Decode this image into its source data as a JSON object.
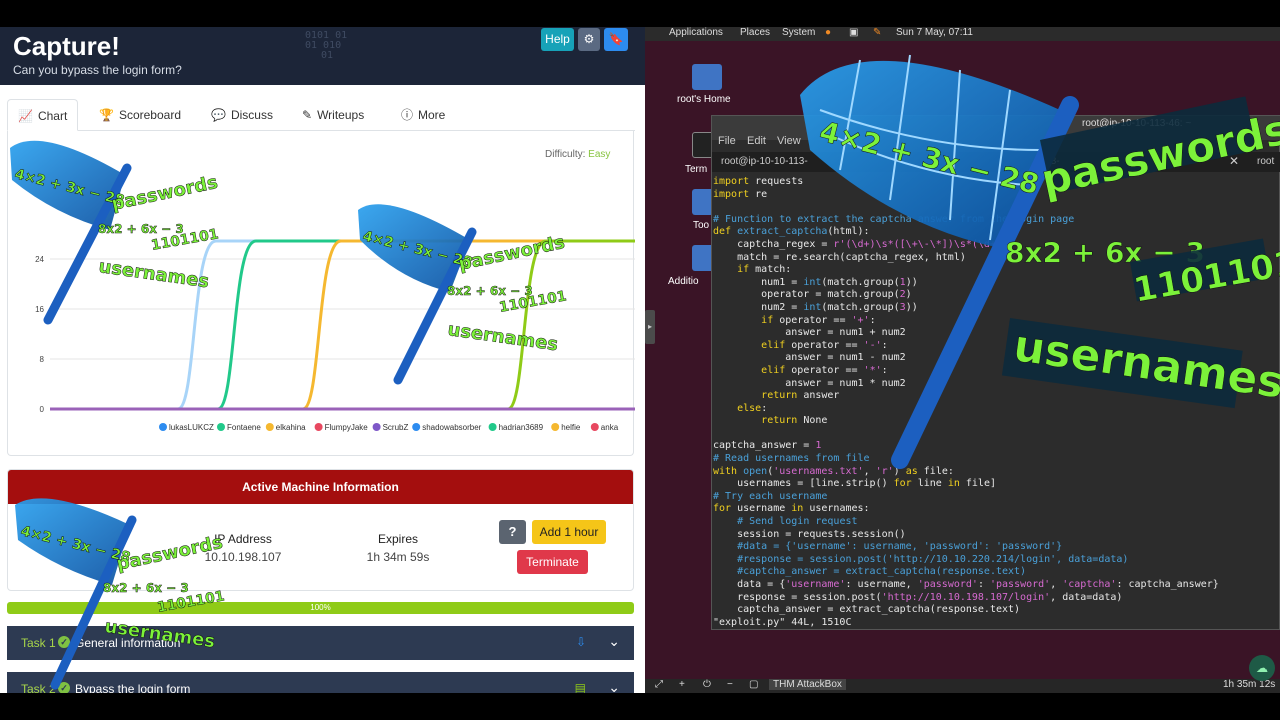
{
  "header": {
    "title": "Capture!",
    "subtitle": "Can you bypass the login form?",
    "binary": [
      "0101 01",
      "01  010",
      "01"
    ],
    "help_label": "Help"
  },
  "tabs": [
    {
      "label": "Chart",
      "icon": "chart-icon"
    },
    {
      "label": "Scoreboard",
      "icon": "trophy-icon"
    },
    {
      "label": "Discuss",
      "icon": "comments-icon"
    },
    {
      "label": "Writeups",
      "icon": "pen-icon"
    },
    {
      "label": "More",
      "icon": "info-icon"
    }
  ],
  "difficulty": {
    "label": "Difficulty:",
    "value": "Easy",
    "color": "#89c442"
  },
  "chart_data": {
    "type": "line",
    "y_ticks": [
      "0",
      "8",
      "16",
      "24"
    ],
    "ylim": [
      0,
      32
    ],
    "legend_position": "bottom",
    "series": [
      {
        "name": "lukasLUKCZ",
        "color": "#2d8cf0"
      },
      {
        "name": "Fontaene",
        "color": "#21c98a"
      },
      {
        "name": "elkahina",
        "color": "#f5b830"
      },
      {
        "name": "FlumpyJake",
        "color": "#e84860"
      },
      {
        "name": "ScrubZ",
        "color": "#7e58c8"
      },
      {
        "name": "shadowabsorber",
        "color": "#2d8cf0"
      },
      {
        "name": "hadrian3689",
        "color": "#21c98a"
      },
      {
        "name": "helfie",
        "color": "#f5b830"
      },
      {
        "name": "anka",
        "color": "#e84860"
      }
    ]
  },
  "machine": {
    "heading": "Active Machine Information",
    "ip_label": "IP Address",
    "ip_value": "10.10.198.107",
    "expires_label": "Expires",
    "expires_value": "1h 34m 59s",
    "help_icon": "?",
    "add_hour_label": "Add 1 hour",
    "terminate_label": "Terminate"
  },
  "progress": {
    "value": 100,
    "label": "100%"
  },
  "tasks": [
    {
      "num": "Task 1",
      "name": "General information"
    },
    {
      "num": "Task 2",
      "name": "Bypass the login form"
    }
  ],
  "desktop": {
    "menu": [
      "Applications",
      "Places",
      "System"
    ],
    "clock": "Sun 7 May, 07:11",
    "icons": [
      "root's Home",
      "Term",
      "Too",
      "Additio"
    ],
    "taskbar_item": "THM AttackBox",
    "taskbar_time": "1h 35m 12s"
  },
  "terminal": {
    "title": "root@ip-10-10-113-46: ~",
    "menu": [
      "File",
      "Edit",
      "View"
    ],
    "tab_left": "root@ip-10-10-113-",
    "tab_mid": "-113-",
    "tab_right": "root",
    "status": "\"exploit.py\" 44L, 1510C"
  },
  "overlay": {
    "equation": "4×2 + 3x − 28",
    "equation2": "8x2 + 6x − 3",
    "word_passwords": "passwords",
    "word_binary": "1101101",
    "word_usernames": "usernames"
  },
  "colors": {
    "header": "#1c2538",
    "machine_heading": "#a40e0e",
    "progress": "#8fcb17",
    "task_bar": "#2d3a52",
    "desktop": "#3a1426"
  }
}
